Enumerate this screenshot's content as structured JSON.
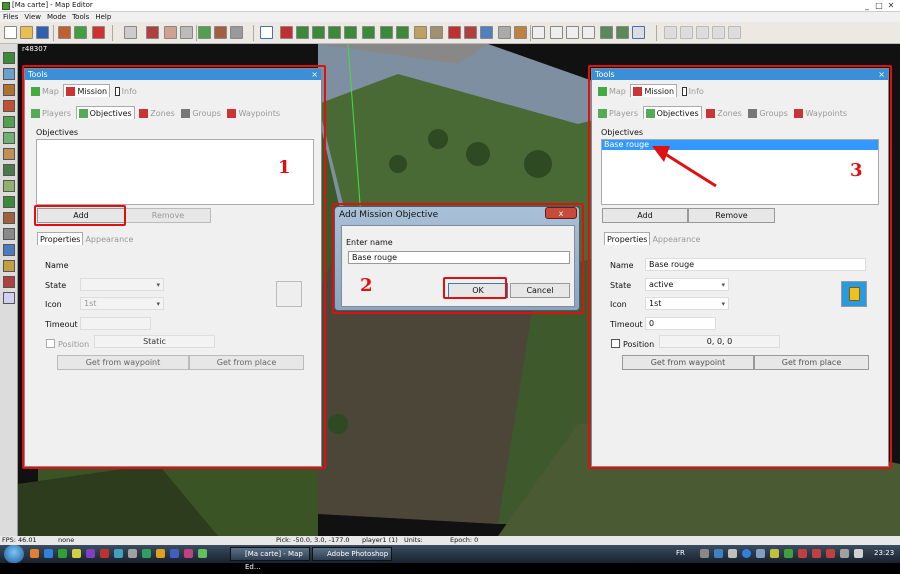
{
  "window": {
    "title": "[Ma carte] - Map Editor",
    "min": "_",
    "max": "□",
    "close": "✕"
  },
  "menu": [
    "Files",
    "View",
    "Mode",
    "Tools",
    "Help"
  ],
  "viewport": {
    "coord": "r48307"
  },
  "left_panel": {
    "title": "Tools",
    "close": "×",
    "top_tabs": [
      {
        "label": "Map",
        "active": false
      },
      {
        "label": "Mission",
        "active": true
      },
      {
        "label": "Info",
        "active": false
      }
    ],
    "sub_tabs": [
      {
        "label": "Players",
        "active": false
      },
      {
        "label": "Objectives",
        "active": true
      },
      {
        "label": "Zones",
        "active": false
      },
      {
        "label": "Groups",
        "active": false
      },
      {
        "label": "Waypoints",
        "active": false
      }
    ],
    "objectives_label": "Objectives",
    "objectives": [],
    "add_label": "Add",
    "remove_label": "Remove",
    "props_tabs": [
      {
        "label": "Properties",
        "active": true
      },
      {
        "label": "Appearance",
        "active": false
      }
    ],
    "name_label": "Name",
    "name_value": "",
    "state_label": "State",
    "state_value": "",
    "icon_label": "Icon",
    "icon_value": "1st",
    "timeout_label": "Timeout",
    "timeout_value": "",
    "position_label": "Position",
    "position_value": "Static",
    "get_waypoint": "Get from waypoint",
    "get_place": "Get from place"
  },
  "dialog": {
    "title": "Add Mission Objective",
    "close": "x",
    "prompt": "Enter name",
    "value": "Base rouge",
    "ok": "OK",
    "cancel": "Cancel"
  },
  "right_panel": {
    "title": "Tools",
    "close": "×",
    "top_tabs": [
      {
        "label": "Map",
        "active": false
      },
      {
        "label": "Mission",
        "active": true
      },
      {
        "label": "Info",
        "active": false
      }
    ],
    "sub_tabs": [
      {
        "label": "Players",
        "active": false
      },
      {
        "label": "Objectives",
        "active": true
      },
      {
        "label": "Zones",
        "active": false
      },
      {
        "label": "Groups",
        "active": false
      },
      {
        "label": "Waypoints",
        "active": false
      }
    ],
    "objectives_label": "Objectives",
    "objectives": [
      "Base rouge"
    ],
    "add_label": "Add",
    "remove_label": "Remove",
    "props_tabs": [
      {
        "label": "Properties",
        "active": true
      },
      {
        "label": "Appearance",
        "active": false
      }
    ],
    "name_label": "Name",
    "name_value": "Base rouge",
    "state_label": "State",
    "state_value": "active",
    "icon_label": "Icon",
    "icon_value": "1st",
    "timeout_label": "Timeout",
    "timeout_value": "0",
    "position_label": "Position",
    "position_value": "0, 0, 0",
    "get_waypoint": "Get from waypoint",
    "get_place": "Get from place"
  },
  "annotations": {
    "one": "1",
    "two": "2",
    "three": "3",
    "color": "#e01010"
  },
  "status": {
    "fps": "FPS: 46.01",
    "mode": "none",
    "pick": "Pick: -50.0, 3.0, -177.0",
    "player": "player1 (1)",
    "units": "Units:",
    "epoch": "Epoch: 0"
  },
  "taskbar": {
    "tasks": [
      "[Ma carte] - Map Ed...",
      "Adobe Photoshop"
    ],
    "lang": "FR",
    "time": "23:23"
  }
}
